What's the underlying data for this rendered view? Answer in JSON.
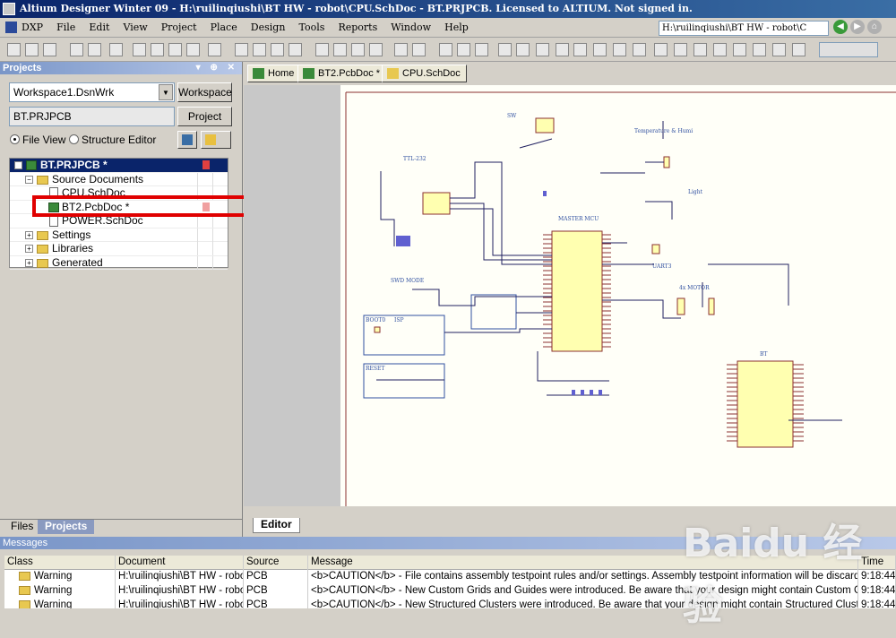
{
  "window": {
    "title": "Altium Designer Winter 09 - H:\\ruilinqiushi\\BT HW - robot\\CPU.SchDoc - BT.PRJPCB. Licensed to ALTIUM. Not signed in."
  },
  "menu": [
    "DXP",
    "File",
    "Edit",
    "View",
    "Project",
    "Place",
    "Design",
    "Tools",
    "Reports",
    "Window",
    "Help"
  ],
  "path_box": "H:\\ruilinqiushi\\BT HW - robot\\C",
  "projects_panel": {
    "title": "Projects",
    "workspace_value": "Workspace1.DsnWrk",
    "workspace_button": "Workspace",
    "project_value": "BT.PRJPCB",
    "project_button": "Project",
    "view_file": "File View",
    "view_structure": "Structure Editor",
    "tree": [
      {
        "label": "BT.PRJPCB *"
      },
      {
        "label": "Source Documents"
      },
      {
        "label": "CPU.SchDoc"
      },
      {
        "label": "BT2.PcbDoc *"
      },
      {
        "label": "POWER.SchDoc"
      },
      {
        "label": "Settings"
      },
      {
        "label": "Libraries"
      },
      {
        "label": "Generated"
      }
    ],
    "bottom_tabs": [
      "Files",
      "Projects"
    ]
  },
  "doc_tabs": [
    "Home",
    "BT2.PcbDoc *",
    "CPU.SchDoc"
  ],
  "editor_tab": "Editor",
  "schematic_labels": {
    "sw": "SW",
    "temp": "Temperature & Humi",
    "ttl": "TTL-232",
    "light": "Light",
    "mcu": "MASTER MCU",
    "uart": "UART3",
    "swd": "SWD MODE",
    "motor": "4x MOTOR",
    "boot": "BOOT0",
    "isp": "ISP",
    "reset": "RESET",
    "bt": "BT"
  },
  "messages_panel": {
    "title": "Messages",
    "columns": [
      "Class",
      "Document",
      "Source",
      "Message",
      "Time"
    ],
    "rows": [
      {
        "class": "Warning",
        "document": "H:\\ruilinqiushi\\BT HW - robo...",
        "source": "PCB",
        "message": "<b>CAUTION</b> - File contains assembly testpoint rules and/or settings.  Assembly testpoint information will be discarded.",
        "time": "9:18:44"
      },
      {
        "class": "Warning",
        "document": "H:\\ruilinqiushi\\BT HW - robo...",
        "source": "PCB",
        "message": "<b>CAUTION</b> - New Custom Grids and Guides were introduced. Be aware that your design might contain Custom Grids and Guid...",
        "time": "9:18:44"
      },
      {
        "class": "Warning",
        "document": "H:\\ruilinqiushi\\BT HW - robo...",
        "source": "PCB",
        "message": "<b>CAUTION</b> - New Structured Clusters were introduced. Be aware that your design might contain Structured Clusters that gene...",
        "time": "9:18:44"
      }
    ]
  },
  "watermark": "Baidu 经验",
  "colors": {
    "selection": "#0a246a",
    "highlight_box": "#e00000",
    "sheet_bg": "#fffff8",
    "ic_fill": "#ffffb0"
  }
}
